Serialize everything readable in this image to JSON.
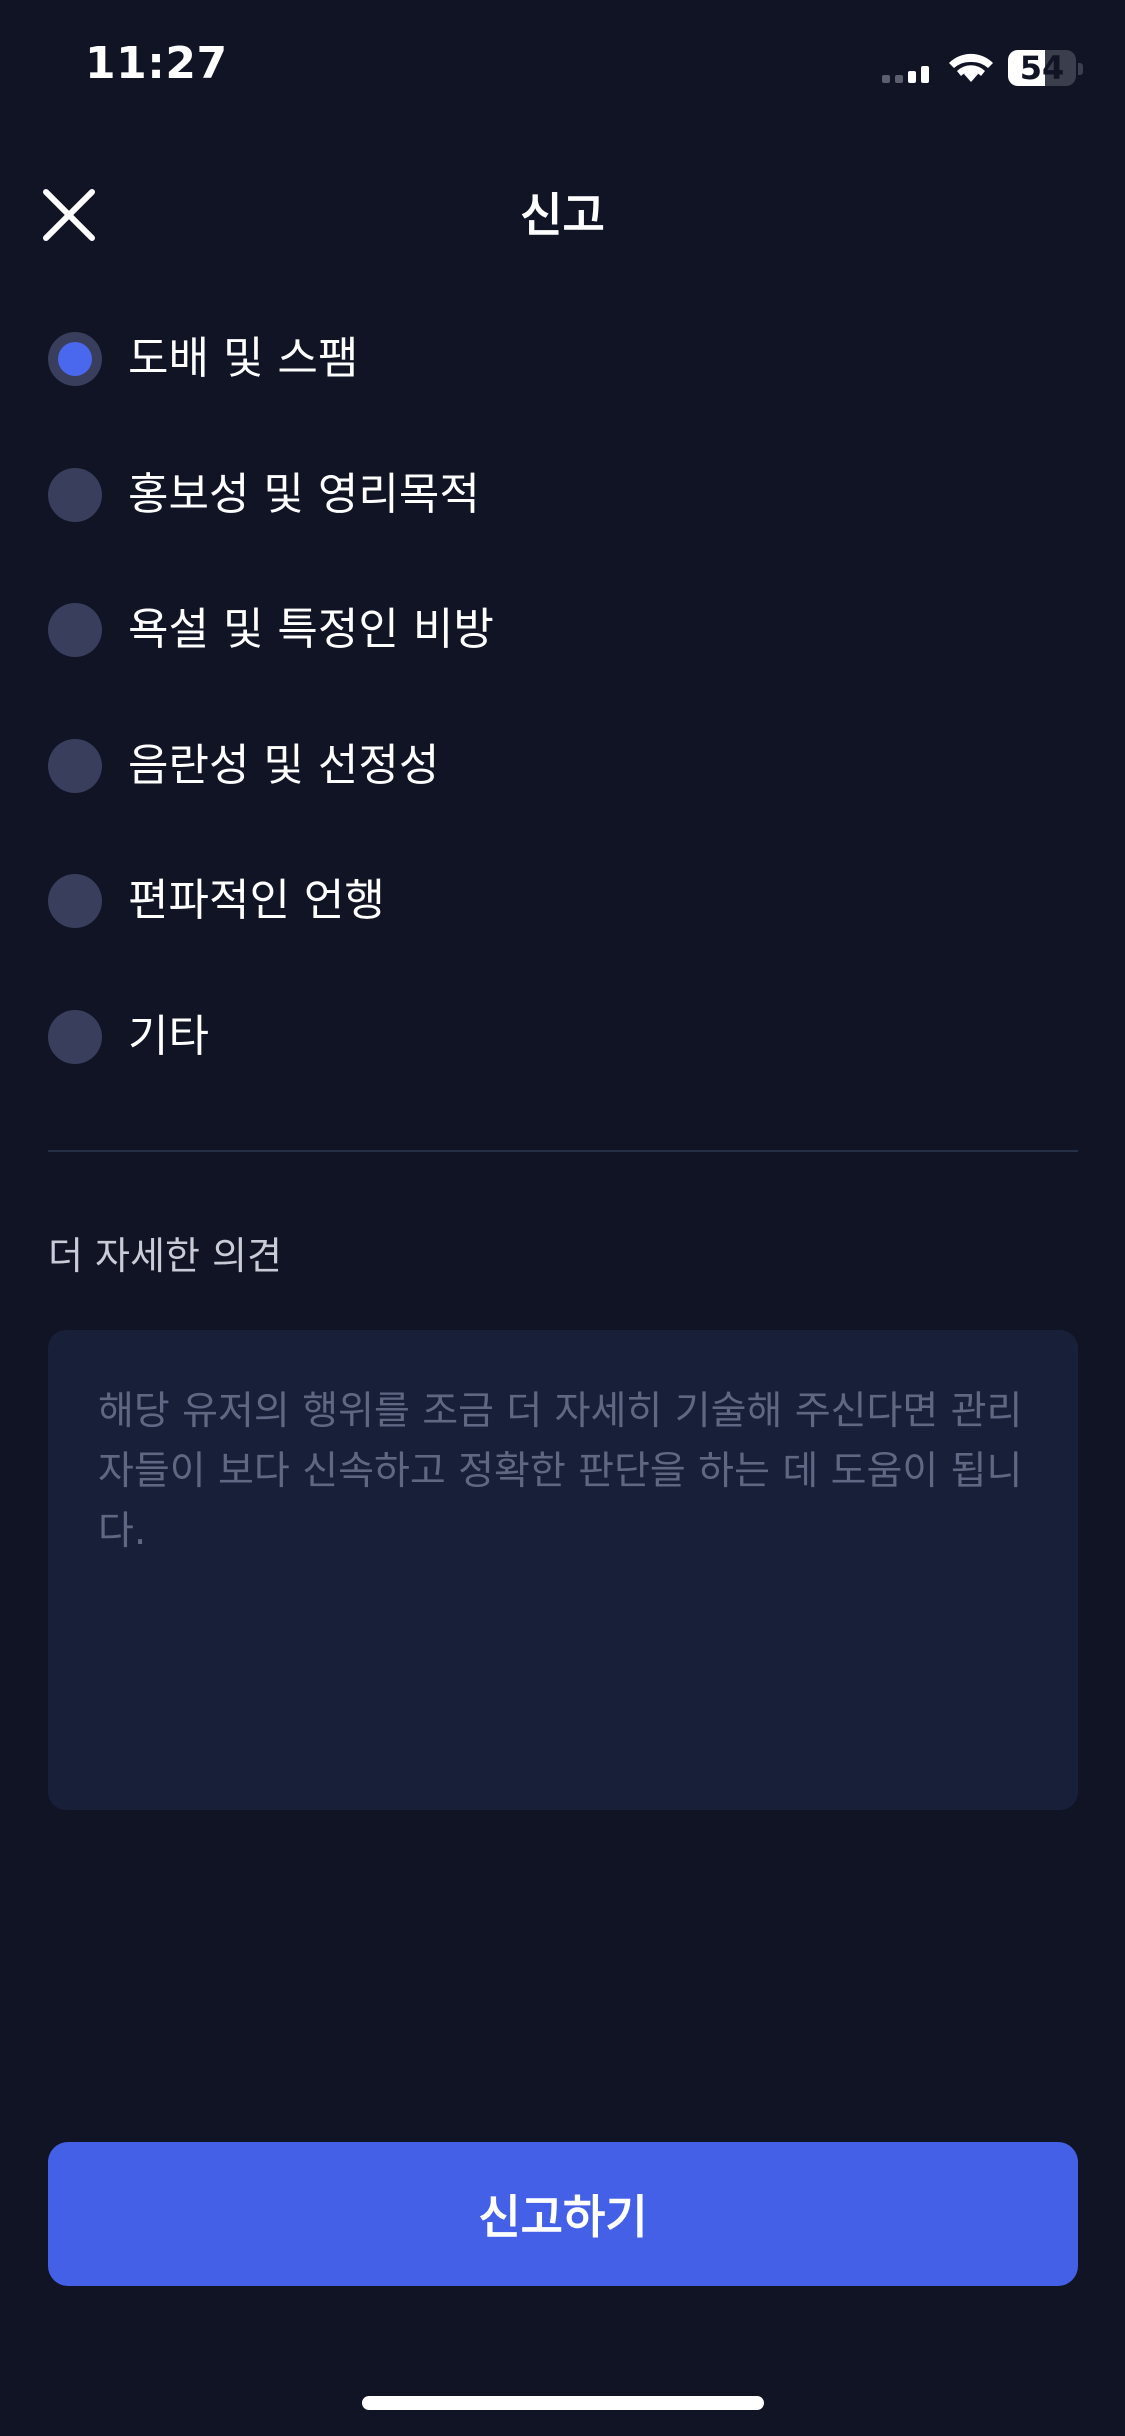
{
  "status_bar": {
    "time": "11:27",
    "battery_level": "54",
    "battery_fraction": 0.54,
    "signal_bars_active": 2,
    "signal_bars_total": 4
  },
  "header": {
    "title": "신고",
    "close_icon": "close-icon"
  },
  "report_reasons": [
    {
      "label": "도배 및 스팸",
      "selected": true
    },
    {
      "label": "홍보성 및 영리목적",
      "selected": false
    },
    {
      "label": "욕설 및 특정인 비방",
      "selected": false
    },
    {
      "label": "음란성 및 선정성",
      "selected": false
    },
    {
      "label": "편파적인 언행",
      "selected": false
    },
    {
      "label": "기타",
      "selected": false
    }
  ],
  "details": {
    "label": "더 자세한 의견",
    "value": "",
    "placeholder": "해당 유저의 행위를 조금 더 자세히 기술해 주신다면 관리자들이 보다 신속하고 정확한 판단을 하는 데 도움이 됩니다."
  },
  "submit": {
    "label": "신고하기"
  },
  "colors": {
    "background": "#111425",
    "accent": "#4360e6",
    "radio_unselected": "#383e5c",
    "textarea_bg": "#181f39",
    "placeholder": "#5f6783"
  }
}
